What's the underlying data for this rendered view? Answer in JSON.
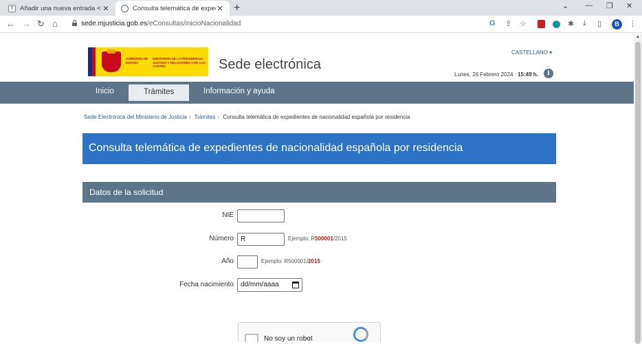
{
  "browser": {
    "tabs": [
      {
        "title": "Añadir una nueva entrada < Abo",
        "favicon": "T"
      },
      {
        "title": "Consulta telemática de expedien"
      }
    ],
    "new_tab": "+",
    "url_domain": "sede.mjusticia.gob.es",
    "url_path": "/eConsultas/inicioNacionalidad",
    "profile_initial": "B"
  },
  "header": {
    "logo_left_text": "GOBIERNO DE ESPAÑA",
    "logo_right_text": "MINISTERIO DE LA PRESIDENCIA, JUSTICIA Y RELACIONES CON LAS CORTES",
    "site_title": "Sede electrónica",
    "language": "CASTELLANO ▾",
    "date": "Lunes, 26 Febrero 2024",
    "time": "15:49 h.",
    "info_icon": "i"
  },
  "nav": {
    "items": [
      "Inicio",
      "Trámites",
      "Información y ayuda"
    ]
  },
  "breadcrumb": {
    "items": [
      "Sede Electrónica del Ministerio de Justicia",
      "Trámites",
      "Consulta telemática de expedientes de nacionalidad española por residencia"
    ]
  },
  "page": {
    "heading": "Consulta telemática de expedientes de nacionalidad española por residencia"
  },
  "form": {
    "section_title": "Datos de la solicitud",
    "nie_label": "NIE",
    "nie_value": "",
    "numero_label": "Número",
    "numero_value": "R",
    "numero_hint_prefix": "Ejemplo: R",
    "numero_hint_highlight": "500001",
    "numero_hint_suffix": "/2015",
    "anio_label": "Año",
    "anio_value": "",
    "anio_hint_prefix": "Ejemplo: R500001/",
    "anio_hint_highlight": "2015",
    "fecha_label": "Fecha nacimiento",
    "fecha_placeholder": "dd/mm/aaaa"
  },
  "captcha": {
    "label": "No soy un robot"
  }
}
